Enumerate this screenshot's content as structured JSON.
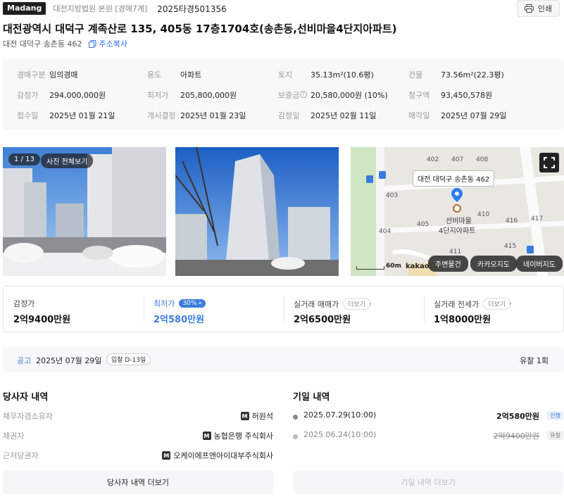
{
  "header": {
    "logo": "Madang",
    "court": "대전지방법원 본원 [경매7계]",
    "case_no": "2025타경501356",
    "print_label": "인쇄"
  },
  "address": {
    "title": "대전광역시 대덕구 계족산로 135, 405동 17층1704호(송촌동,선비마을4단지아파트)",
    "jibun": "대전 대덕구 송촌동 462",
    "copy_label": "주소복사"
  },
  "info": [
    [
      {
        "label": "경매구분",
        "value": "임의경매"
      },
      {
        "label": "용도",
        "value": "아파트"
      },
      {
        "label": "토지",
        "value": "35.13m²(10.6평)"
      },
      {
        "label": "건물",
        "value": "73.56m²(22.3평)"
      }
    ],
    [
      {
        "label": "감정가",
        "value": "294,000,000원"
      },
      {
        "label": "최저가",
        "value": "205,800,000원"
      },
      {
        "label": "보증금",
        "value": "20,580,000원 (10%)"
      },
      {
        "label": "청구액",
        "value": "93,450,578원"
      }
    ],
    [
      {
        "label": "접수일",
        "value": "2025년 01월 21일"
      },
      {
        "label": "개시결정",
        "value": "2025년 01월 23일"
      },
      {
        "label": "감정일",
        "value": "2025년 02월 11일"
      },
      {
        "label": "매각일",
        "value": "2025년 07월 29일"
      }
    ]
  ],
  "photos": {
    "counter": "1 / 13",
    "view_all": "사진 전체보기"
  },
  "map": {
    "address_bubble": "대전 대덕구 송촌동 462",
    "place_name_1": "선비마을",
    "place_name_2": "4단지아파트",
    "scale_label": "60m",
    "kakao_logo": "kakao",
    "buttons": [
      "주변물건",
      "카카오지도",
      "네이버지도"
    ],
    "building_numbers": [
      "402",
      "407",
      "408",
      "403",
      "405",
      "410",
      "416",
      "417",
      "404",
      "415",
      "411"
    ]
  },
  "prices": {
    "appraisal_label": "감정가",
    "appraisal_value": "2억9400만원",
    "min_label": "최저가",
    "min_badge": "30%",
    "min_value": "2억580만원",
    "trade_label": "실거래 매매가",
    "trade_more": "더보기",
    "trade_value": "2억6500만원",
    "lease_label": "실거래 전세가",
    "lease_more": "더보기",
    "lease_value": "1억8000만원",
    "accent_color": "#3b7ddd"
  },
  "notice": {
    "label": "공고",
    "date": "2025년 07월 29일",
    "badge": "입찰 D-13일",
    "fail_count": "유찰 1회"
  },
  "parties": {
    "title": "당사자 내역",
    "rows": [
      {
        "label": "채무자겸소유자",
        "value": "허원석"
      },
      {
        "label": "채권자",
        "value": "농협은행 주식회사"
      },
      {
        "label": "근저당권자",
        "value": "오케이에프앤아이대부주식회사"
      }
    ],
    "more_label": "당사자 내역 더보기"
  },
  "dates": {
    "title": "기일 내역",
    "rows": [
      {
        "date": "2025.07.29(10:00)",
        "price": "2억580만원",
        "status": "진행"
      },
      {
        "date": "2025.06.24(10:00)",
        "price": "2억9400만원",
        "status": "유찰"
      }
    ],
    "more_label": "기일 내역 더보기"
  }
}
